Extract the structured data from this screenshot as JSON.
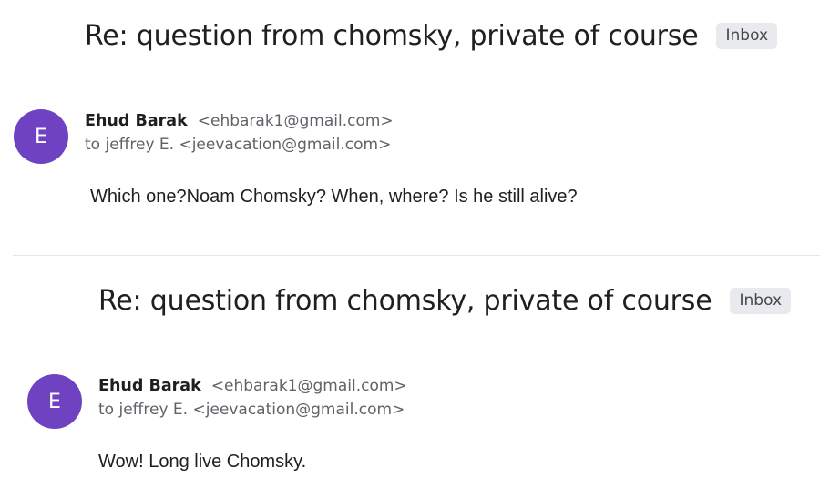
{
  "messages": [
    {
      "subject": "Re: question from chomsky, private of course",
      "label": "Inbox",
      "avatar_initial": "E",
      "sender_name": "Ehud Barak",
      "sender_email": "<ehbarak1@gmail.com>",
      "to_line": "to jeffrey E. <jeevacation@gmail.com>",
      "body": "Which one?Noam Chomsky? When, where? Is he still alive?"
    },
    {
      "subject": "Re: question from chomsky, private of course",
      "label": "Inbox",
      "avatar_initial": "E",
      "sender_name": "Ehud Barak",
      "sender_email": "<ehbarak1@gmail.com>",
      "to_line": "to jeffrey E. <jeevacation@gmail.com>",
      "body": "Wow! Long live Chomsky."
    }
  ],
  "colors": {
    "avatar": "#6f42c1",
    "chip_bg": "#e8eaed",
    "secondary_text": "#5f6368"
  }
}
